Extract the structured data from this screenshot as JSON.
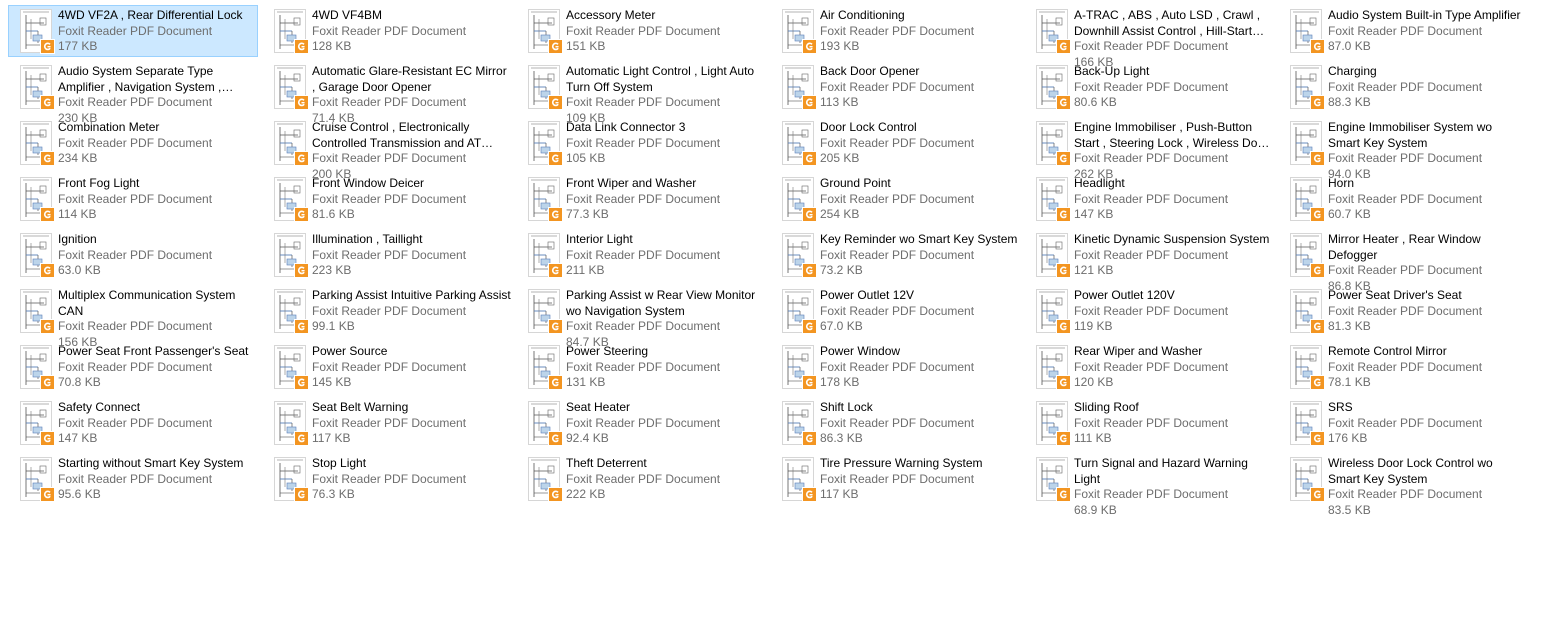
{
  "file_type": "Foxit Reader PDF Document",
  "badge_icon": "foxit-pdf-icon",
  "colors": {
    "selection_bg": "#cce8ff",
    "selection_border": "#99d1ff",
    "badge": "#f39521",
    "secondary_text": "#6d6d6d"
  },
  "files": [
    {
      "name": "4WD VF2A , Rear Differential Lock",
      "size": "177 KB",
      "selected": true
    },
    {
      "name": "4WD VF4BM",
      "size": "128 KB"
    },
    {
      "name": "Accessory Meter",
      "size": "151 KB"
    },
    {
      "name": "Air Conditioning",
      "size": "193 KB"
    },
    {
      "name": "A-TRAC , ABS , Auto LSD , Crawl , Downhill Assist Control , Hill-Start Assist Control , TRC , VSC",
      "size": "166 KB"
    },
    {
      "name": "Audio System Built-in Type Amplifier",
      "size": "87.0 KB"
    },
    {
      "name": "Audio System Separate Type Amplifier , Navigation System , Panoramic View Monitor",
      "size": "230 KB"
    },
    {
      "name": "Automatic Glare-Resistant EC Mirror , Garage Door Opener",
      "size": "71.4 KB"
    },
    {
      "name": "Automatic Light Control , Light Auto Turn Off System",
      "size": "109 KB"
    },
    {
      "name": "Back Door Opener",
      "size": "113 KB"
    },
    {
      "name": "Back-Up Light",
      "size": "80.6 KB"
    },
    {
      "name": "Charging",
      "size": "88.3 KB"
    },
    {
      "name": "Combination Meter",
      "size": "234 KB"
    },
    {
      "name": "Cruise Control , Electronically Controlled Transmission and AT Indicator",
      "size": "200 KB"
    },
    {
      "name": "Data Link Connector 3",
      "size": "105 KB"
    },
    {
      "name": "Door Lock Control",
      "size": "205 KB"
    },
    {
      "name": "Engine Immobiliser , Push-Button Start , Steering Lock , Wireless Door Lock Control",
      "size": "262 KB"
    },
    {
      "name": "Engine Immobiliser System wo Smart Key System",
      "size": "94.0 KB"
    },
    {
      "name": "Front Fog Light",
      "size": "114 KB"
    },
    {
      "name": "Front Window Deicer",
      "size": "81.6 KB"
    },
    {
      "name": "Front Wiper and Washer",
      "size": "77.3 KB"
    },
    {
      "name": "Ground Point",
      "size": "254 KB"
    },
    {
      "name": "Headlight",
      "size": "147 KB"
    },
    {
      "name": "Horn",
      "size": "60.7 KB"
    },
    {
      "name": "Ignition",
      "size": "63.0 KB"
    },
    {
      "name": "Illumination , Taillight",
      "size": "223 KB"
    },
    {
      "name": "Interior Light",
      "size": "211 KB"
    },
    {
      "name": "Key Reminder wo Smart Key System",
      "size": "73.2 KB"
    },
    {
      "name": "Kinetic Dynamic Suspension System",
      "size": "121 KB"
    },
    {
      "name": "Mirror Heater , Rear Window Defogger",
      "size": "86.8 KB"
    },
    {
      "name": "Multiplex Communication System CAN",
      "size": "156 KB"
    },
    {
      "name": "Parking Assist Intuitive Parking Assist",
      "size": "99.1 KB"
    },
    {
      "name": "Parking Assist w Rear View Monitor wo Navigation System",
      "size": "84.7 KB"
    },
    {
      "name": "Power Outlet 12V",
      "size": "67.0 KB"
    },
    {
      "name": "Power Outlet 120V",
      "size": "119 KB"
    },
    {
      "name": "Power Seat Driver's Seat",
      "size": "81.3 KB"
    },
    {
      "name": "Power Seat Front Passenger's Seat",
      "size": "70.8 KB"
    },
    {
      "name": "Power Source",
      "size": "145 KB"
    },
    {
      "name": "Power Steering",
      "size": "131 KB"
    },
    {
      "name": "Power Window",
      "size": "178 KB"
    },
    {
      "name": "Rear Wiper and Washer",
      "size": "120 KB"
    },
    {
      "name": "Remote Control Mirror",
      "size": "78.1 KB"
    },
    {
      "name": "Safety Connect",
      "size": "147 KB"
    },
    {
      "name": "Seat Belt Warning",
      "size": "117 KB"
    },
    {
      "name": "Seat Heater",
      "size": "92.4 KB"
    },
    {
      "name": "Shift Lock",
      "size": "86.3 KB"
    },
    {
      "name": "Sliding Roof",
      "size": "111 KB"
    },
    {
      "name": "SRS",
      "size": "176 KB"
    },
    {
      "name": "Starting without Smart Key System",
      "size": "95.6 KB"
    },
    {
      "name": "Stop Light",
      "size": "76.3 KB"
    },
    {
      "name": "Theft Deterrent",
      "size": "222 KB"
    },
    {
      "name": "Tire Pressure Warning System",
      "size": "117 KB"
    },
    {
      "name": "Turn Signal and Hazard Warning Light",
      "size": "68.9 KB"
    },
    {
      "name": "Wireless Door Lock Control wo Smart Key System",
      "size": "83.5 KB"
    }
  ]
}
